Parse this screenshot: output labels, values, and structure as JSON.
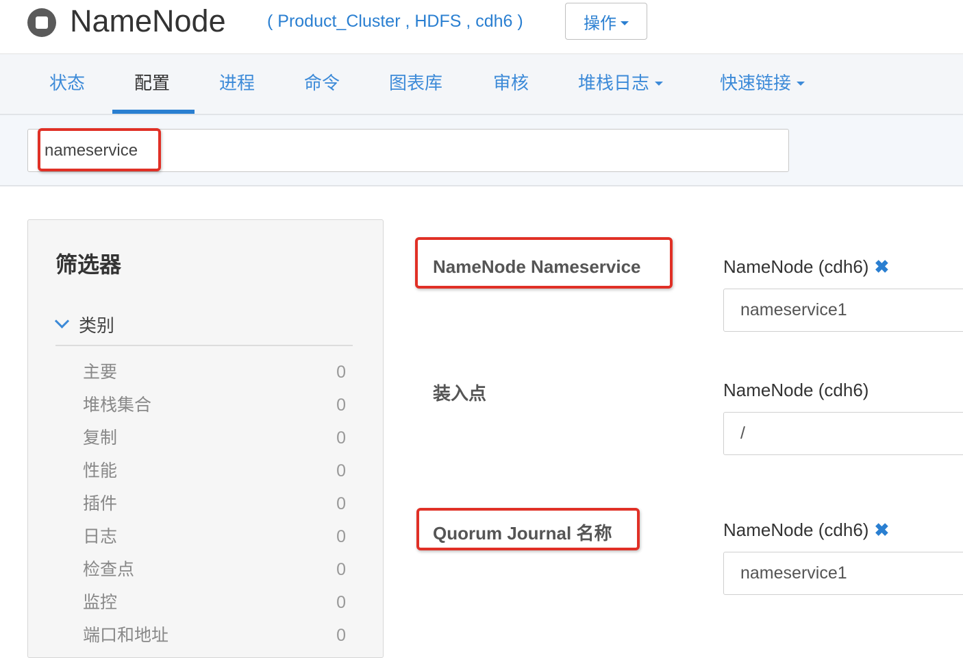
{
  "header": {
    "title": "NameNode",
    "context": "( Product_Cluster , HDFS , cdh6 )",
    "actions_label": "操作"
  },
  "tabs": [
    {
      "label": "状态"
    },
    {
      "label": "配置",
      "active": true
    },
    {
      "label": "进程"
    },
    {
      "label": "命令"
    },
    {
      "label": "图表库"
    },
    {
      "label": "审核"
    },
    {
      "label": "堆栈日志",
      "dropdown": true
    },
    {
      "label": "快速链接",
      "dropdown": true
    }
  ],
  "search": {
    "value": "nameservice"
  },
  "filters": {
    "title": "筛选器",
    "category_label": "类别",
    "items": [
      {
        "label": "主要",
        "count": "0"
      },
      {
        "label": "堆栈集合",
        "count": "0"
      },
      {
        "label": "复制",
        "count": "0"
      },
      {
        "label": "性能",
        "count": "0"
      },
      {
        "label": "插件",
        "count": "0"
      },
      {
        "label": "日志",
        "count": "0"
      },
      {
        "label": "检查点",
        "count": "0"
      },
      {
        "label": "监控",
        "count": "0"
      },
      {
        "label": "端口和地址",
        "count": "0"
      }
    ]
  },
  "config": [
    {
      "label": "NameNode Nameservice",
      "scope": "NameNode (cdh6)",
      "removable": true,
      "value": "nameservice1"
    },
    {
      "label": "装入点",
      "scope": "NameNode (cdh6)",
      "removable": false,
      "value": "/"
    },
    {
      "label": "Quorum Journal 名称",
      "scope": "NameNode (cdh6)",
      "removable": true,
      "value": "nameservice1"
    }
  ],
  "colors": {
    "accent": "#2a7fd1",
    "highlight": "#e03026"
  }
}
